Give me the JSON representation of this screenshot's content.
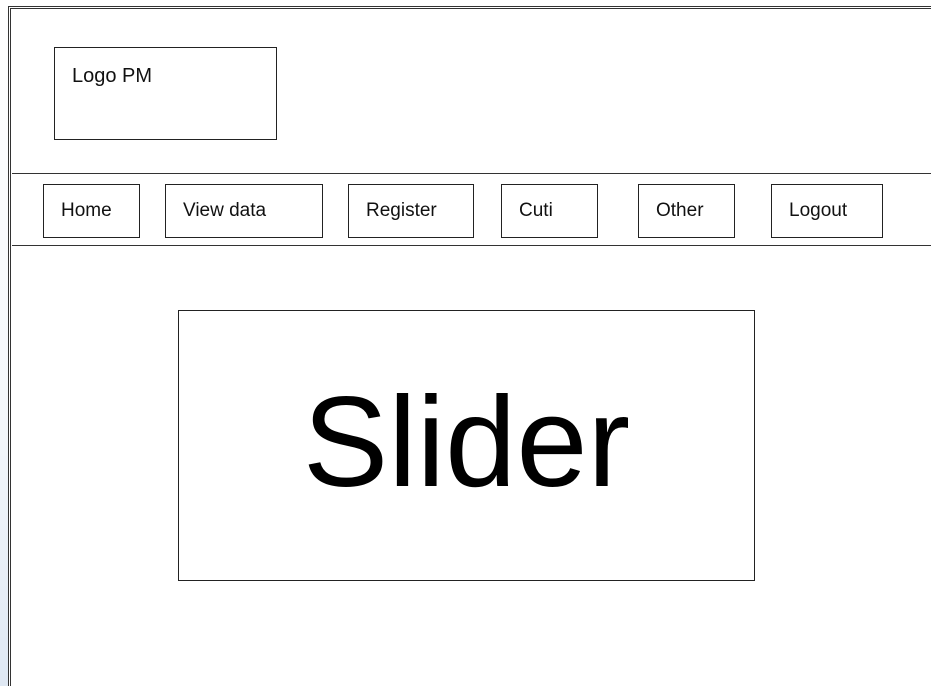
{
  "header": {
    "logo_text": "Logo PM"
  },
  "nav": {
    "items": [
      {
        "label": "Home"
      },
      {
        "label": "View data"
      },
      {
        "label": "Register"
      },
      {
        "label": "Cuti"
      },
      {
        "label": "Other"
      },
      {
        "label": "Logout"
      }
    ]
  },
  "main": {
    "slider_text": "Slider"
  }
}
